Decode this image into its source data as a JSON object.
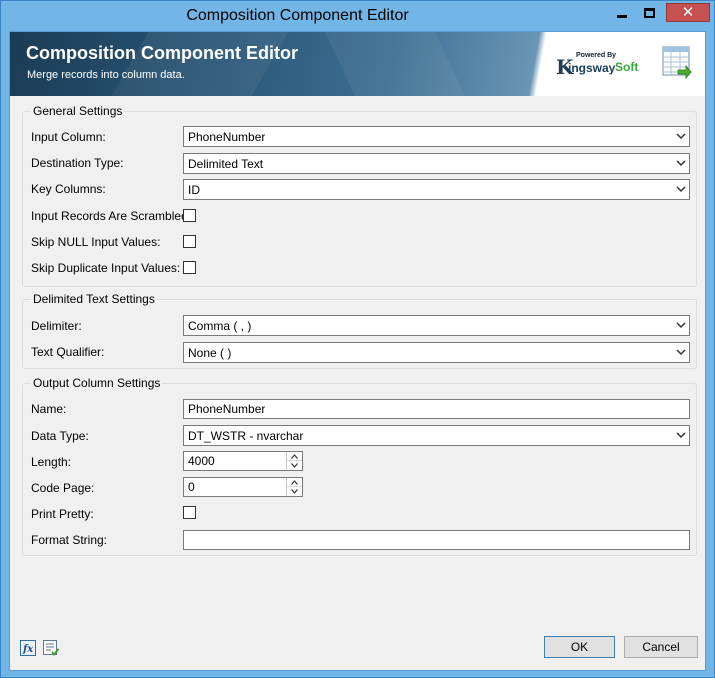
{
  "window": {
    "title": "Composition Component Editor",
    "close_glyph": "✕"
  },
  "banner": {
    "title": "Composition Component Editor",
    "subtitle": "Merge records into column data.",
    "logo": {
      "powered_by": "Powered By",
      "brand_k": "K",
      "brand_mid": "ingsway",
      "brand_end": "Soft"
    }
  },
  "general_settings": {
    "title": "General Settings",
    "input_column": {
      "label": "Input Column:",
      "value": "PhoneNumber"
    },
    "destination_type": {
      "label": "Destination Type:",
      "value": "Delimited Text"
    },
    "key_columns": {
      "label": "Key Columns:",
      "value": "ID"
    },
    "input_records_scrambled": {
      "label": "Input Records Are Scrambled:",
      "checked": false
    },
    "skip_null": {
      "label": "Skip NULL Input Values:",
      "checked": false
    },
    "skip_duplicate": {
      "label": "Skip Duplicate Input Values:",
      "checked": false
    }
  },
  "delimited_text_settings": {
    "title": "Delimited Text Settings",
    "delimiter": {
      "label": "Delimiter:",
      "value": "Comma ( , )"
    },
    "text_qualifier": {
      "label": "Text Qualifier:",
      "value": "None (  )"
    }
  },
  "output_column_settings": {
    "title": "Output Column Settings",
    "name": {
      "label": "Name:",
      "value": "PhoneNumber"
    },
    "data_type": {
      "label": "Data Type:",
      "value": "DT_WSTR - nvarchar"
    },
    "length": {
      "label": "Length:",
      "value": "4000"
    },
    "code_page": {
      "label": "Code Page:",
      "value": "0"
    },
    "print_pretty": {
      "label": "Print Pretty:",
      "checked": false
    },
    "format_string": {
      "label": "Format String:",
      "value": ""
    }
  },
  "footer": {
    "ok_label": "OK",
    "cancel_label": "Cancel",
    "icons": [
      "expression-fx-icon",
      "validate-list-icon"
    ]
  },
  "colors": {
    "title_bar": "#72b6e8",
    "close_button": "#c75050",
    "banner_dark": "#1b3c56",
    "dialog_bg": "#f0f0f0",
    "brand_green": "#39a83a"
  }
}
